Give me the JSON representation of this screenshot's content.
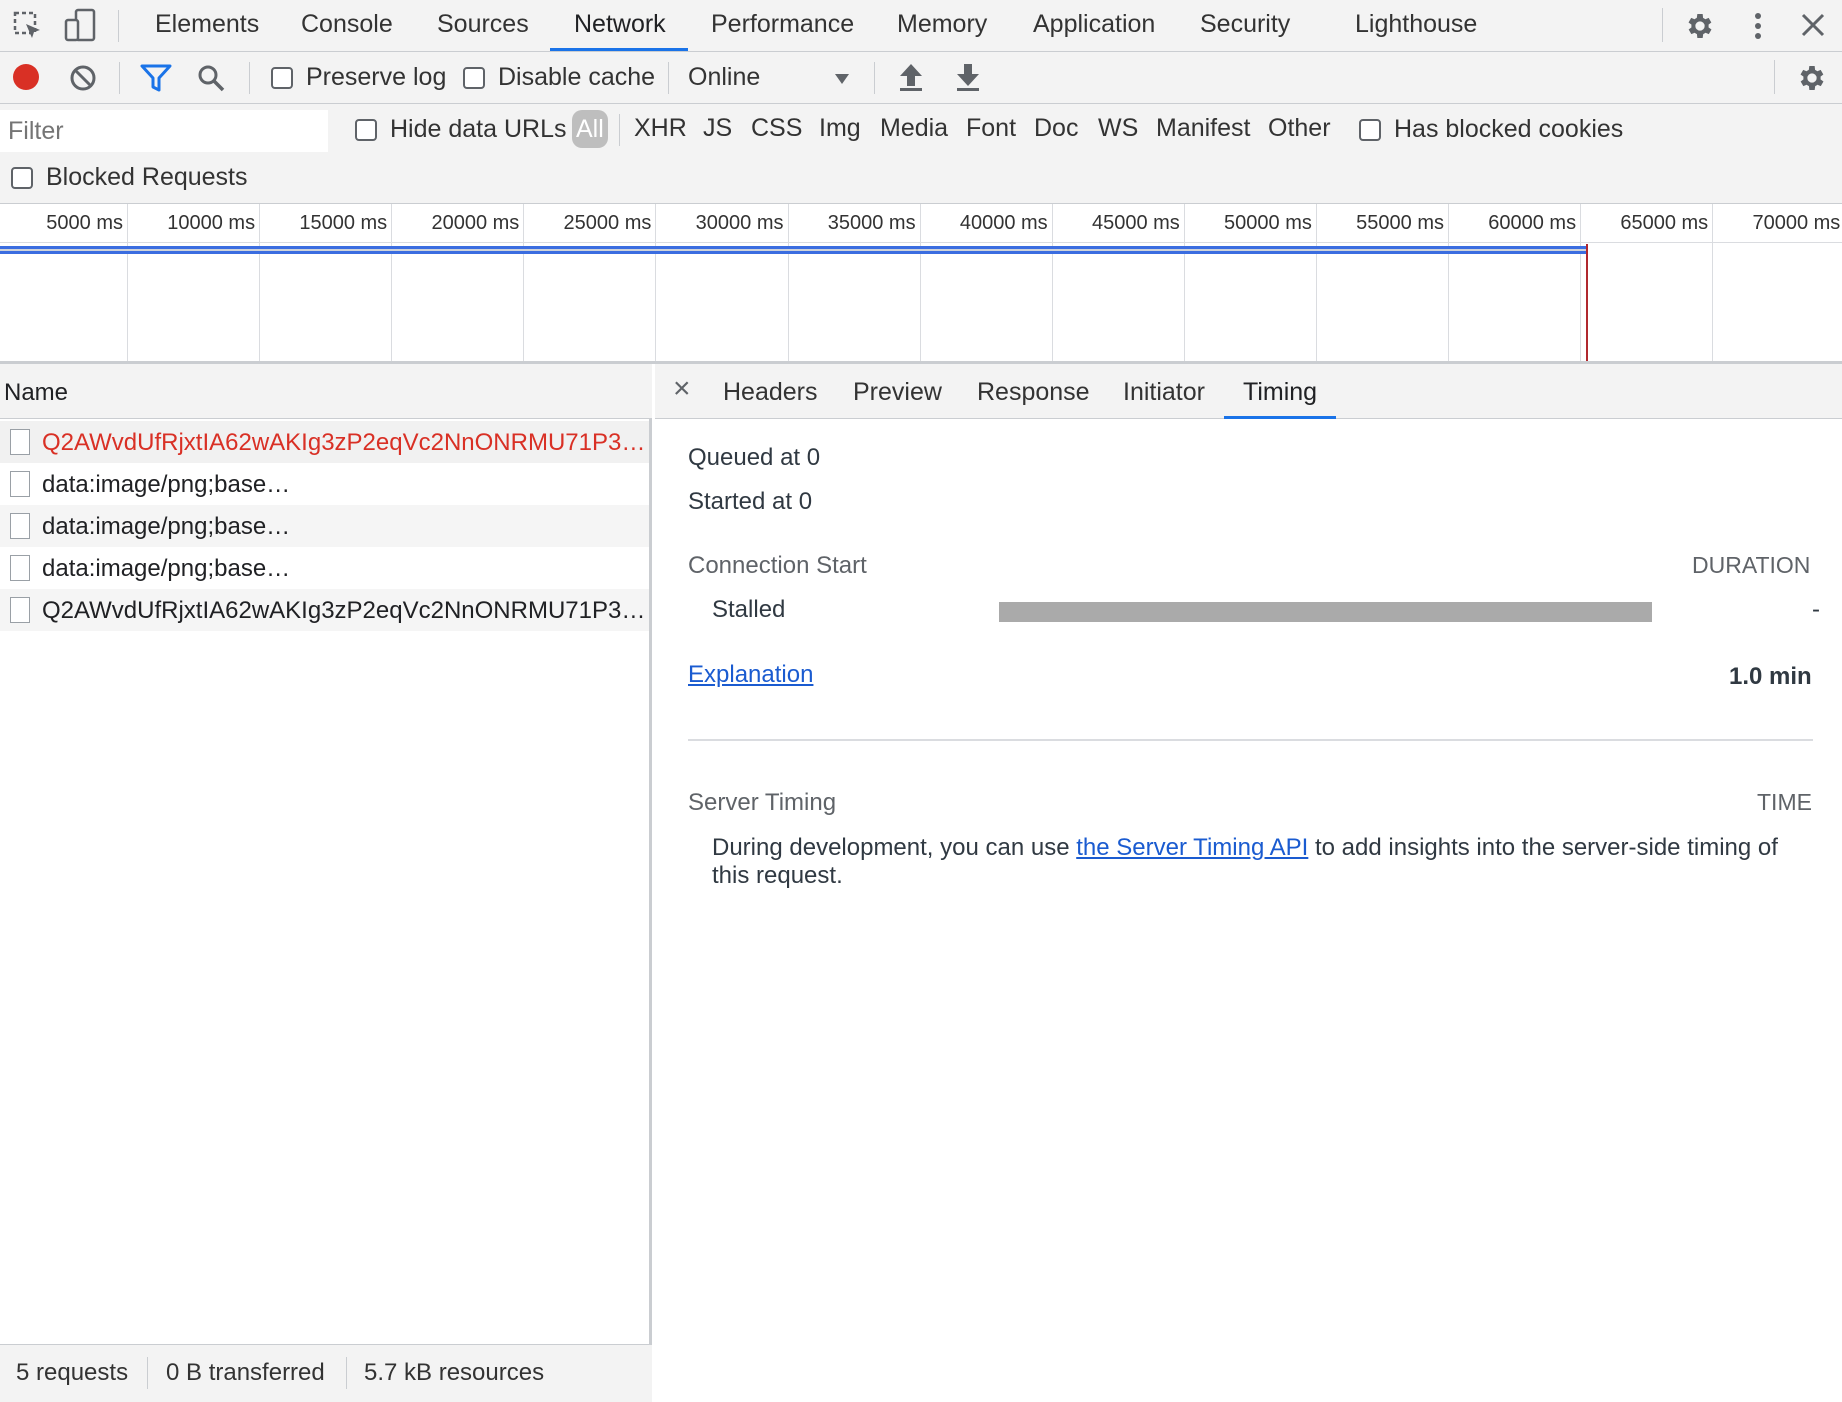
{
  "tabbar": {
    "tabs": [
      "Elements",
      "Console",
      "Sources",
      "Network",
      "Performance",
      "Memory",
      "Application",
      "Security",
      "Lighthouse"
    ],
    "active_tab": "Network"
  },
  "toolbar": {
    "preserve_log_label": "Preserve log",
    "disable_cache_label": "Disable cache",
    "throttling_value": "Online"
  },
  "filterbar": {
    "filter_placeholder": "Filter",
    "hide_data_urls_label": "Hide data URLs",
    "types": [
      "All",
      "XHR",
      "JS",
      "CSS",
      "Img",
      "Media",
      "Font",
      "Doc",
      "WS",
      "Manifest",
      "Other"
    ],
    "active_type": "All",
    "has_blocked_cookies_label": "Has blocked cookies",
    "blocked_requests_label": "Blocked Requests"
  },
  "timeline": {
    "ticks": [
      "5000 ms",
      "10000 ms",
      "15000 ms",
      "20000 ms",
      "25000 ms",
      "30000 ms",
      "35000 ms",
      "40000 ms",
      "45000 ms",
      "50000 ms",
      "55000 ms",
      "60000 ms",
      "65000 ms",
      "70000 ms"
    ]
  },
  "request_list": {
    "header": "Name",
    "rows": [
      {
        "name": "Q2AWvdUfRjxtIA62wAKIg3zP2eqVc2NnONRMU71P3…",
        "error": true
      },
      {
        "name": "data:image/png;base…",
        "error": false
      },
      {
        "name": "data:image/png;base…",
        "error": false
      },
      {
        "name": "data:image/png;base…",
        "error": false
      },
      {
        "name": "Q2AWvdUfRjxtIA62wAKIg3zP2eqVc2NnONRMU71P3…",
        "error": false
      }
    ]
  },
  "status": {
    "requests": "5 requests",
    "transferred": "0 B transferred",
    "resources": "5.7 kB resources"
  },
  "detail": {
    "close": "×",
    "tabs": [
      "Headers",
      "Preview",
      "Response",
      "Initiator",
      "Timing"
    ],
    "active_tab": "Timing",
    "queued": "Queued at 0",
    "started": "Started at 0",
    "connection_start": "Connection Start",
    "duration_header": "DURATION",
    "stalled_label": "Stalled",
    "stalled_value": "-",
    "explanation_link": "Explanation",
    "total": "1.0 min",
    "server_timing": "Server Timing",
    "time_header": "TIME",
    "server_text_before": "During development, you can use ",
    "server_link": "the Server Timing API",
    "server_text_after": " to add insights into the server-side timing of",
    "server_text_line2": "this request."
  }
}
